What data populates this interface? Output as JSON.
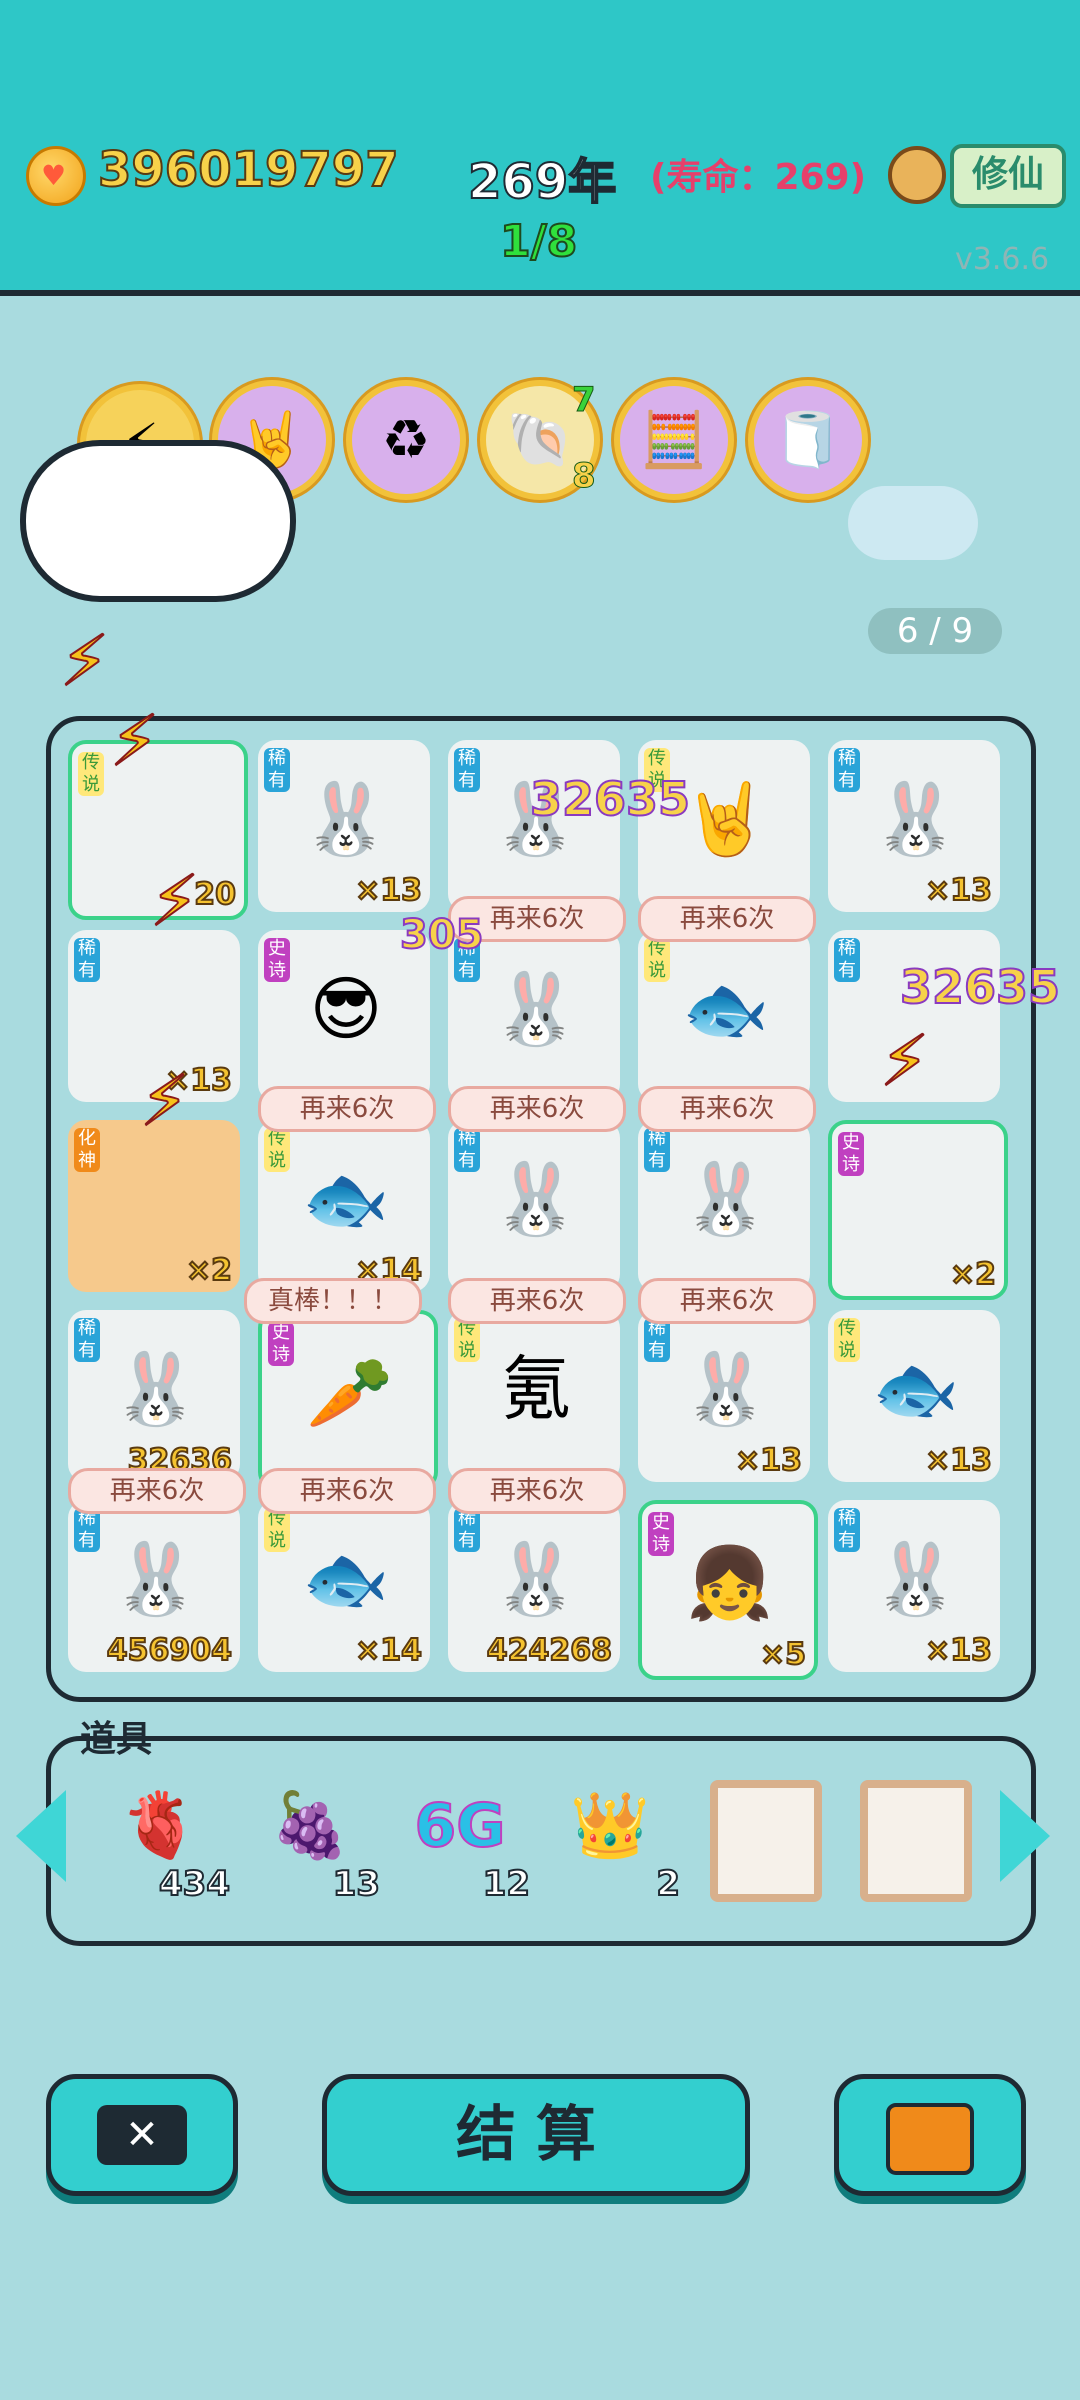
{
  "header": {
    "coins": "396019797",
    "year": "269年",
    "lifespan": "(寿命：269)",
    "level": "1/8",
    "cultivate_button": "修仙",
    "version": "v3.6.6"
  },
  "buffs": [
    {
      "name": "lightning-buff-icon",
      "count": ""
    },
    {
      "name": "rock-hand-buff-icon",
      "count": ""
    },
    {
      "name": "recycle-buff-icon",
      "count": ""
    },
    {
      "name": "shell-buff-icon",
      "count_top": "7",
      "count_bottom": "8"
    },
    {
      "name": "calculator-man-buff-icon",
      "count": ""
    },
    {
      "name": "tissue-box-buff-icon",
      "count": ""
    }
  ],
  "spin_progress": "6 / 9",
  "board": {
    "floating_values": [
      "32635",
      "305",
      "32635"
    ],
    "again_label": "再来6次",
    "praise_label": "真棒！！！",
    "cells": [
      {
        "rarity": "传说",
        "sprite": "",
        "qty": "20"
      },
      {
        "rarity": "稀有",
        "sprite": "🐰",
        "qty": "×13"
      },
      {
        "rarity": "稀有",
        "sprite": "🐰",
        "qty": ""
      },
      {
        "rarity": "传说",
        "sprite": "🤘",
        "qty": ""
      },
      {
        "rarity": "稀有",
        "sprite": "🐰",
        "qty": "×13"
      },
      {
        "rarity": "稀有",
        "sprite": "",
        "qty": "×13"
      },
      {
        "rarity": "史诗",
        "sprite": "😎",
        "qty": ""
      },
      {
        "rarity": "稀有",
        "sprite": "🐰",
        "qty": ""
      },
      {
        "rarity": "传说",
        "sprite": "🐟",
        "qty": ""
      },
      {
        "rarity": "稀有",
        "sprite": "",
        "qty": ""
      },
      {
        "rarity": "化神",
        "sprite": "",
        "qty": "×2"
      },
      {
        "rarity": "传说",
        "sprite": "🐟",
        "qty": "×14"
      },
      {
        "rarity": "稀有",
        "sprite": "🐰",
        "qty": ""
      },
      {
        "rarity": "稀有",
        "sprite": "🐰",
        "qty": ""
      },
      {
        "rarity": "史诗",
        "sprite": "",
        "qty": "×2"
      },
      {
        "rarity": "稀有",
        "sprite": "🐰",
        "qty": "32636"
      },
      {
        "rarity": "史诗",
        "sprite": "🥕",
        "qty": ""
      },
      {
        "rarity": "传说",
        "sprite": "氪",
        "qty": ""
      },
      {
        "rarity": "稀有",
        "sprite": "🐰",
        "qty": "×13"
      },
      {
        "rarity": "传说",
        "sprite": "🐟",
        "qty": "×13"
      },
      {
        "rarity": "稀有",
        "sprite": "🐰",
        "qty": "456904"
      },
      {
        "rarity": "传说",
        "sprite": "🐟",
        "qty": "×14"
      },
      {
        "rarity": "稀有",
        "sprite": "🐰",
        "qty": "424268"
      },
      {
        "rarity": "史诗",
        "sprite": "👧",
        "qty": "×5"
      },
      {
        "rarity": "稀有",
        "sprite": "🐰",
        "qty": "×13"
      }
    ]
  },
  "tools": {
    "label": "道具",
    "items": [
      {
        "name": "liver-icon",
        "glyph": "🫀",
        "count": "434"
      },
      {
        "name": "bayberry-icon",
        "glyph": "🍇",
        "count": "13"
      },
      {
        "name": "6g-icon",
        "glyph": "6G",
        "count": "12"
      },
      {
        "name": "crown-icon",
        "glyph": "👑",
        "count": "2"
      }
    ]
  },
  "buttons": {
    "close": "✕",
    "settle": "结算"
  }
}
